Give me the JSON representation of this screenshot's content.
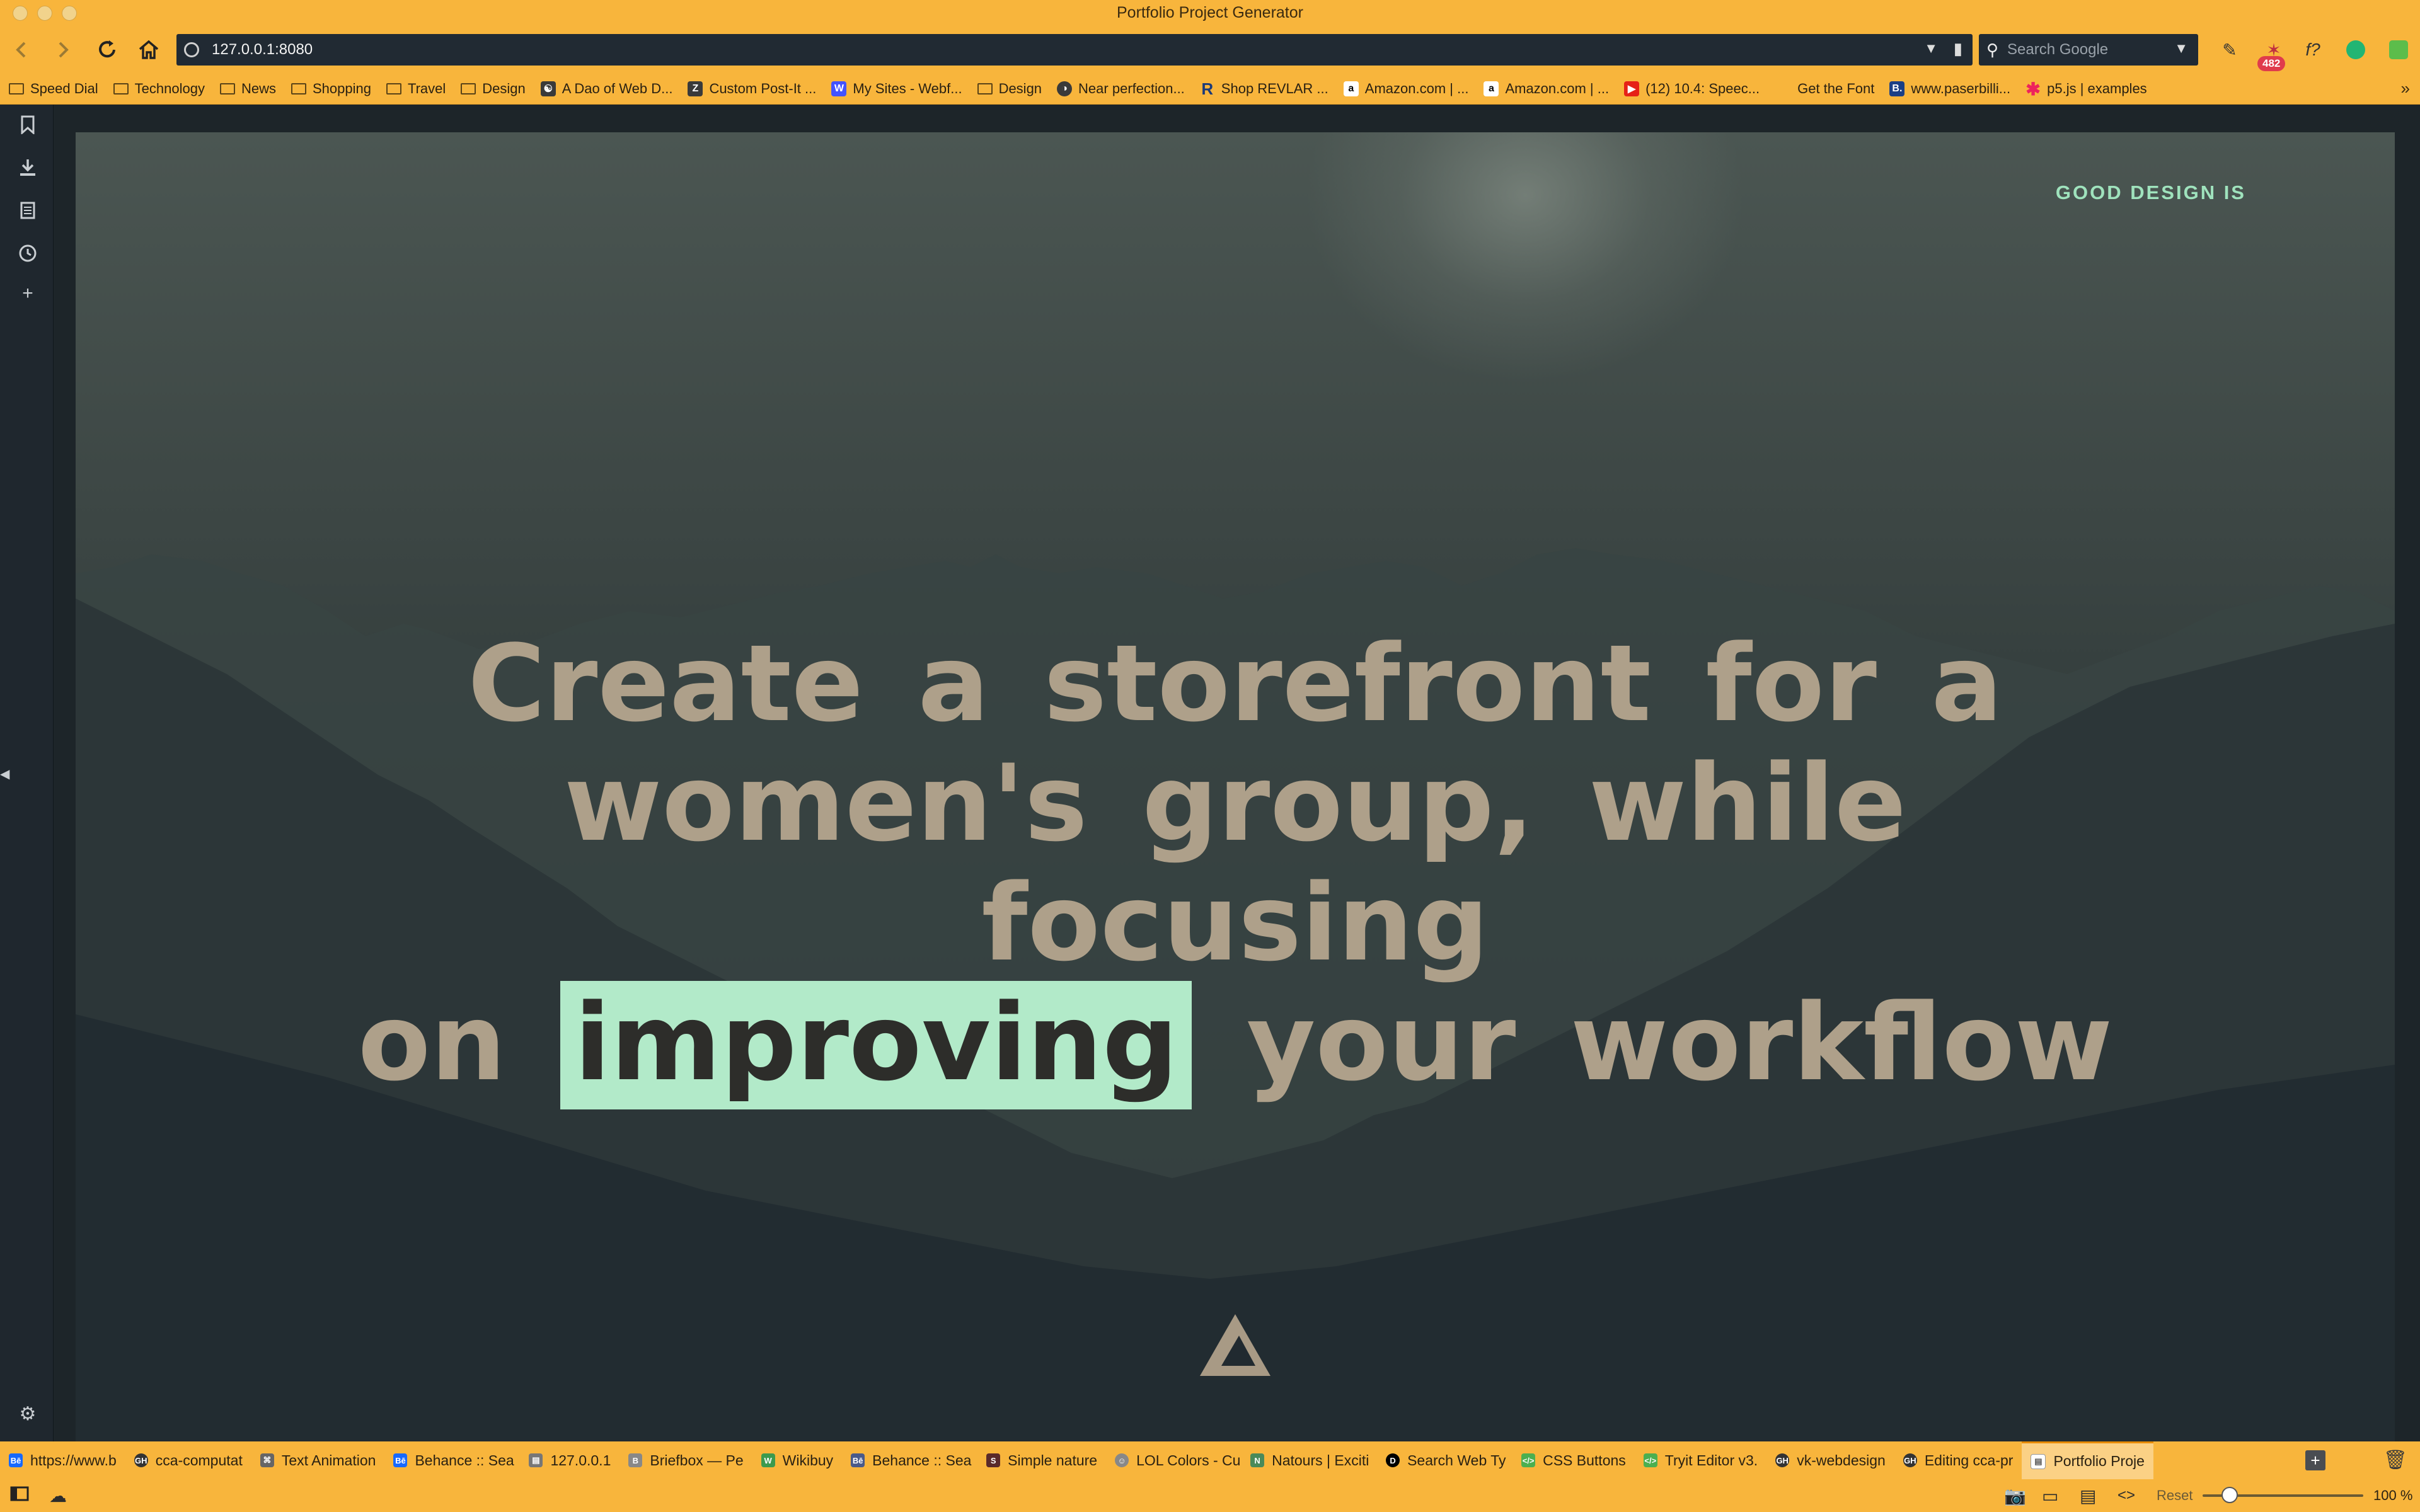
{
  "window": {
    "title": "Portfolio Project Generator"
  },
  "toolbar": {
    "back_icon": "arrow-left-icon",
    "forward_icon": "arrow-right-icon",
    "reload_icon": "reload-icon",
    "home_icon": "home-icon",
    "url": "127.0.0.1:8080",
    "search_placeholder": "Search Google",
    "extension_badge": "482"
  },
  "bookmarks": [
    {
      "label": "Speed Dial",
      "icon": "folder-icon"
    },
    {
      "label": "Technology",
      "icon": "folder-icon"
    },
    {
      "label": "News",
      "icon": "folder-icon"
    },
    {
      "label": "Shopping",
      "icon": "folder-icon"
    },
    {
      "label": "Travel",
      "icon": "folder-icon"
    },
    {
      "label": "Design",
      "icon": "folder-icon"
    },
    {
      "label": "A Dao of Web D...",
      "icon": "site-icon"
    },
    {
      "label": "Custom Post-It ...",
      "icon": "site-icon"
    },
    {
      "label": "My Sites - Webf...",
      "icon": "site-icon"
    },
    {
      "label": "Design",
      "icon": "folder-icon"
    },
    {
      "label": "Near perfection...",
      "icon": "site-icon"
    },
    {
      "label": "Shop REVLAR ...",
      "icon": "site-icon"
    },
    {
      "label": "Amazon.com | ...",
      "icon": "amazon-icon"
    },
    {
      "label": "Amazon.com | ...",
      "icon": "amazon-icon"
    },
    {
      "label": "(12) 10.4: Speec...",
      "icon": "youtube-icon"
    },
    {
      "label": "Get the Font",
      "icon": "none"
    },
    {
      "label": "www.paserbilli...",
      "icon": "site-icon"
    },
    {
      "label": "p5.js | examples",
      "icon": "star-icon"
    }
  ],
  "page": {
    "eyebrow": "GOOD DESIGN IS",
    "headline_line1": "Create a storefront for a",
    "headline_line2": "women's group, while focusing",
    "headline_line3_pre": "on",
    "headline_highlight": "improving",
    "headline_line3_post": "your workflow",
    "highlight_color": "#b2eac9",
    "headline_color": "#aea08a",
    "eyebrow_color": "#9fe3bd"
  },
  "tabs": [
    {
      "label": "https://www.b",
      "icon": "Bē"
    },
    {
      "label": "cca-computat",
      "icon": "GH"
    },
    {
      "label": "Text Animation",
      "icon": "⌘"
    },
    {
      "label": "Behance :: Sea",
      "icon": "Bē"
    },
    {
      "label": "127.0.0.1",
      "icon": "▤"
    },
    {
      "label": "Briefbox — Pe",
      "icon": "B"
    },
    {
      "label": "Wikibuy",
      "icon": "W"
    },
    {
      "label": "Behance :: Sea",
      "icon": "Bē"
    },
    {
      "label": "Simple nature",
      "icon": "S"
    },
    {
      "label": "LOL Colors - Cu",
      "icon": "☺"
    },
    {
      "label": "Natours | Exciti",
      "icon": "N"
    },
    {
      "label": "Search Web Ty",
      "icon": "D"
    },
    {
      "label": "CSS Buttons",
      "icon": "</>"
    },
    {
      "label": "Tryit Editor v3.",
      "icon": "</>"
    },
    {
      "label": "vk-webdesign",
      "icon": "GH"
    },
    {
      "label": "Editing cca-pr",
      "icon": "GH"
    },
    {
      "label": "Portfolio Proje",
      "icon": "▤",
      "active": true
    }
  ],
  "statusbar": {
    "reset_label": "Reset",
    "zoom_level": "100 %",
    "zoom_fraction": 0.12
  }
}
